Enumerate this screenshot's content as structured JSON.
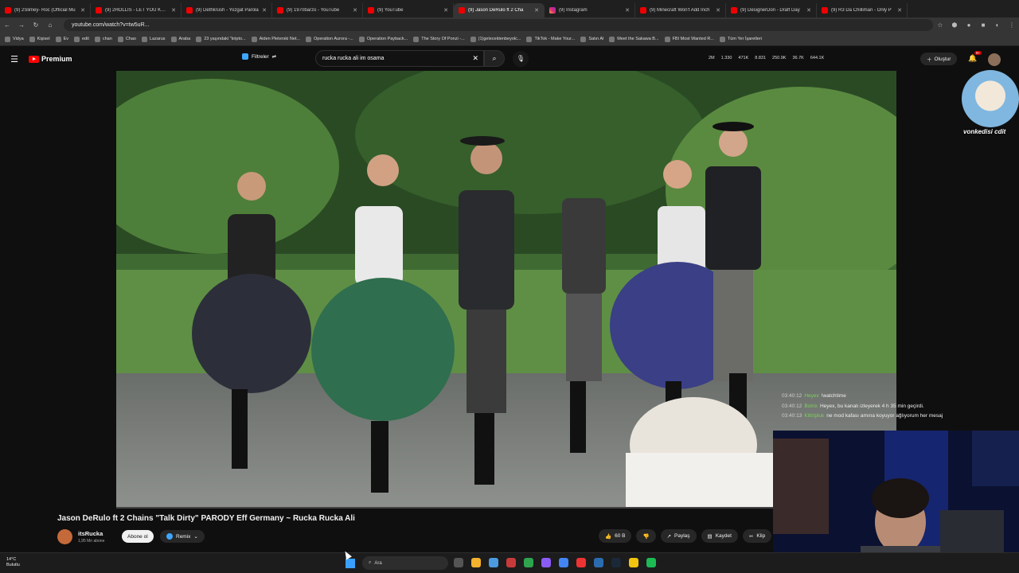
{
  "browser": {
    "tabs": [
      {
        "label": "(9) 2Slimey- Roc (Official Mu",
        "favicon": "youtube"
      },
      {
        "label": "(9) 2HOLLIS - LET YOU KNOW",
        "favicon": "youtube"
      },
      {
        "label": "(9) Dethkrüsh - Yozgat Parola",
        "favicon": "youtube"
      },
      {
        "label": "(9) 1970barzo - YouTube",
        "favicon": "youtube"
      },
      {
        "label": "(9) YouTube",
        "favicon": "youtube"
      },
      {
        "label": "(9) Jason DeRulo ft 2 Cha",
        "favicon": "youtube",
        "active": true
      },
      {
        "label": "(9) Instagram",
        "favicon": "instagram"
      },
      {
        "label": "(9) Minecraft Won't Add Inch",
        "favicon": "youtube"
      },
      {
        "label": "(9) DesignerDon - Draft Day",
        "favicon": "youtube"
      },
      {
        "label": "(9) R3 Da Chilliman - Only P",
        "favicon": "youtube"
      }
    ],
    "url": "youtube.com/watch?v=tw5uR...",
    "bookmarks": [
      "Vidya",
      "Kişisel",
      "Ev",
      "edit",
      "chan",
      "Chao",
      "Lazarus",
      "Araba",
      "23 yaşındaki \"kripto...",
      "Aiden Pleterski Net...",
      "Operation Aurora -...",
      "Operation Payback...",
      "The Story Of Ponzi -...",
      "(1)gelecektenbeyolc...",
      "TikTok - Make Your...",
      "Satın Al",
      "Meet the Sakawa B...",
      "FBI Most Wanted R...",
      "Tüm Yer İşaretleri"
    ]
  },
  "youtube": {
    "logo_label": "Premium",
    "filters_label": "Filtreler",
    "search_value": "rucka rucka ali im osama",
    "stats": [
      "2M",
      "1.330",
      "471K",
      "8.831",
      "250.9K",
      "36.7K",
      "644.1K"
    ],
    "create_label": "Oluştur",
    "notification_count": "9+"
  },
  "overlay": {
    "cat_caption": "vonkedisi cdit",
    "chat": [
      {
        "time": "03:40:12",
        "user": "Heyex",
        "msg": "!watchtime"
      },
      {
        "time": "03:40:12",
        "user": "Botrix",
        "msg": "Heyex, bu kanalı izleyerek 4 h 35 min geçirdi."
      },
      {
        "time": "03:40:13",
        "user": "Kiltrtpluk",
        "msg": "ne mod kafası amına koyuyor ağlıyorum her mesaj"
      }
    ]
  },
  "video": {
    "title": "Jason DeRulo ft 2 Chains \"Talk Dirty\" PARODY Eff Germany ~ Rucka Rucka Ali",
    "channel": "itsRucka",
    "subscribers": "1,95 Mn abone",
    "subscribe_label": "Abone ol",
    "remix_label": "Remix",
    "likes": "60 B",
    "share_label": "Paylaş",
    "save_label": "Kaydet",
    "clip_label": "Klip"
  },
  "taskbar": {
    "temperature": "14°C",
    "weather": "Bulutlu",
    "search_label": "Ara"
  }
}
